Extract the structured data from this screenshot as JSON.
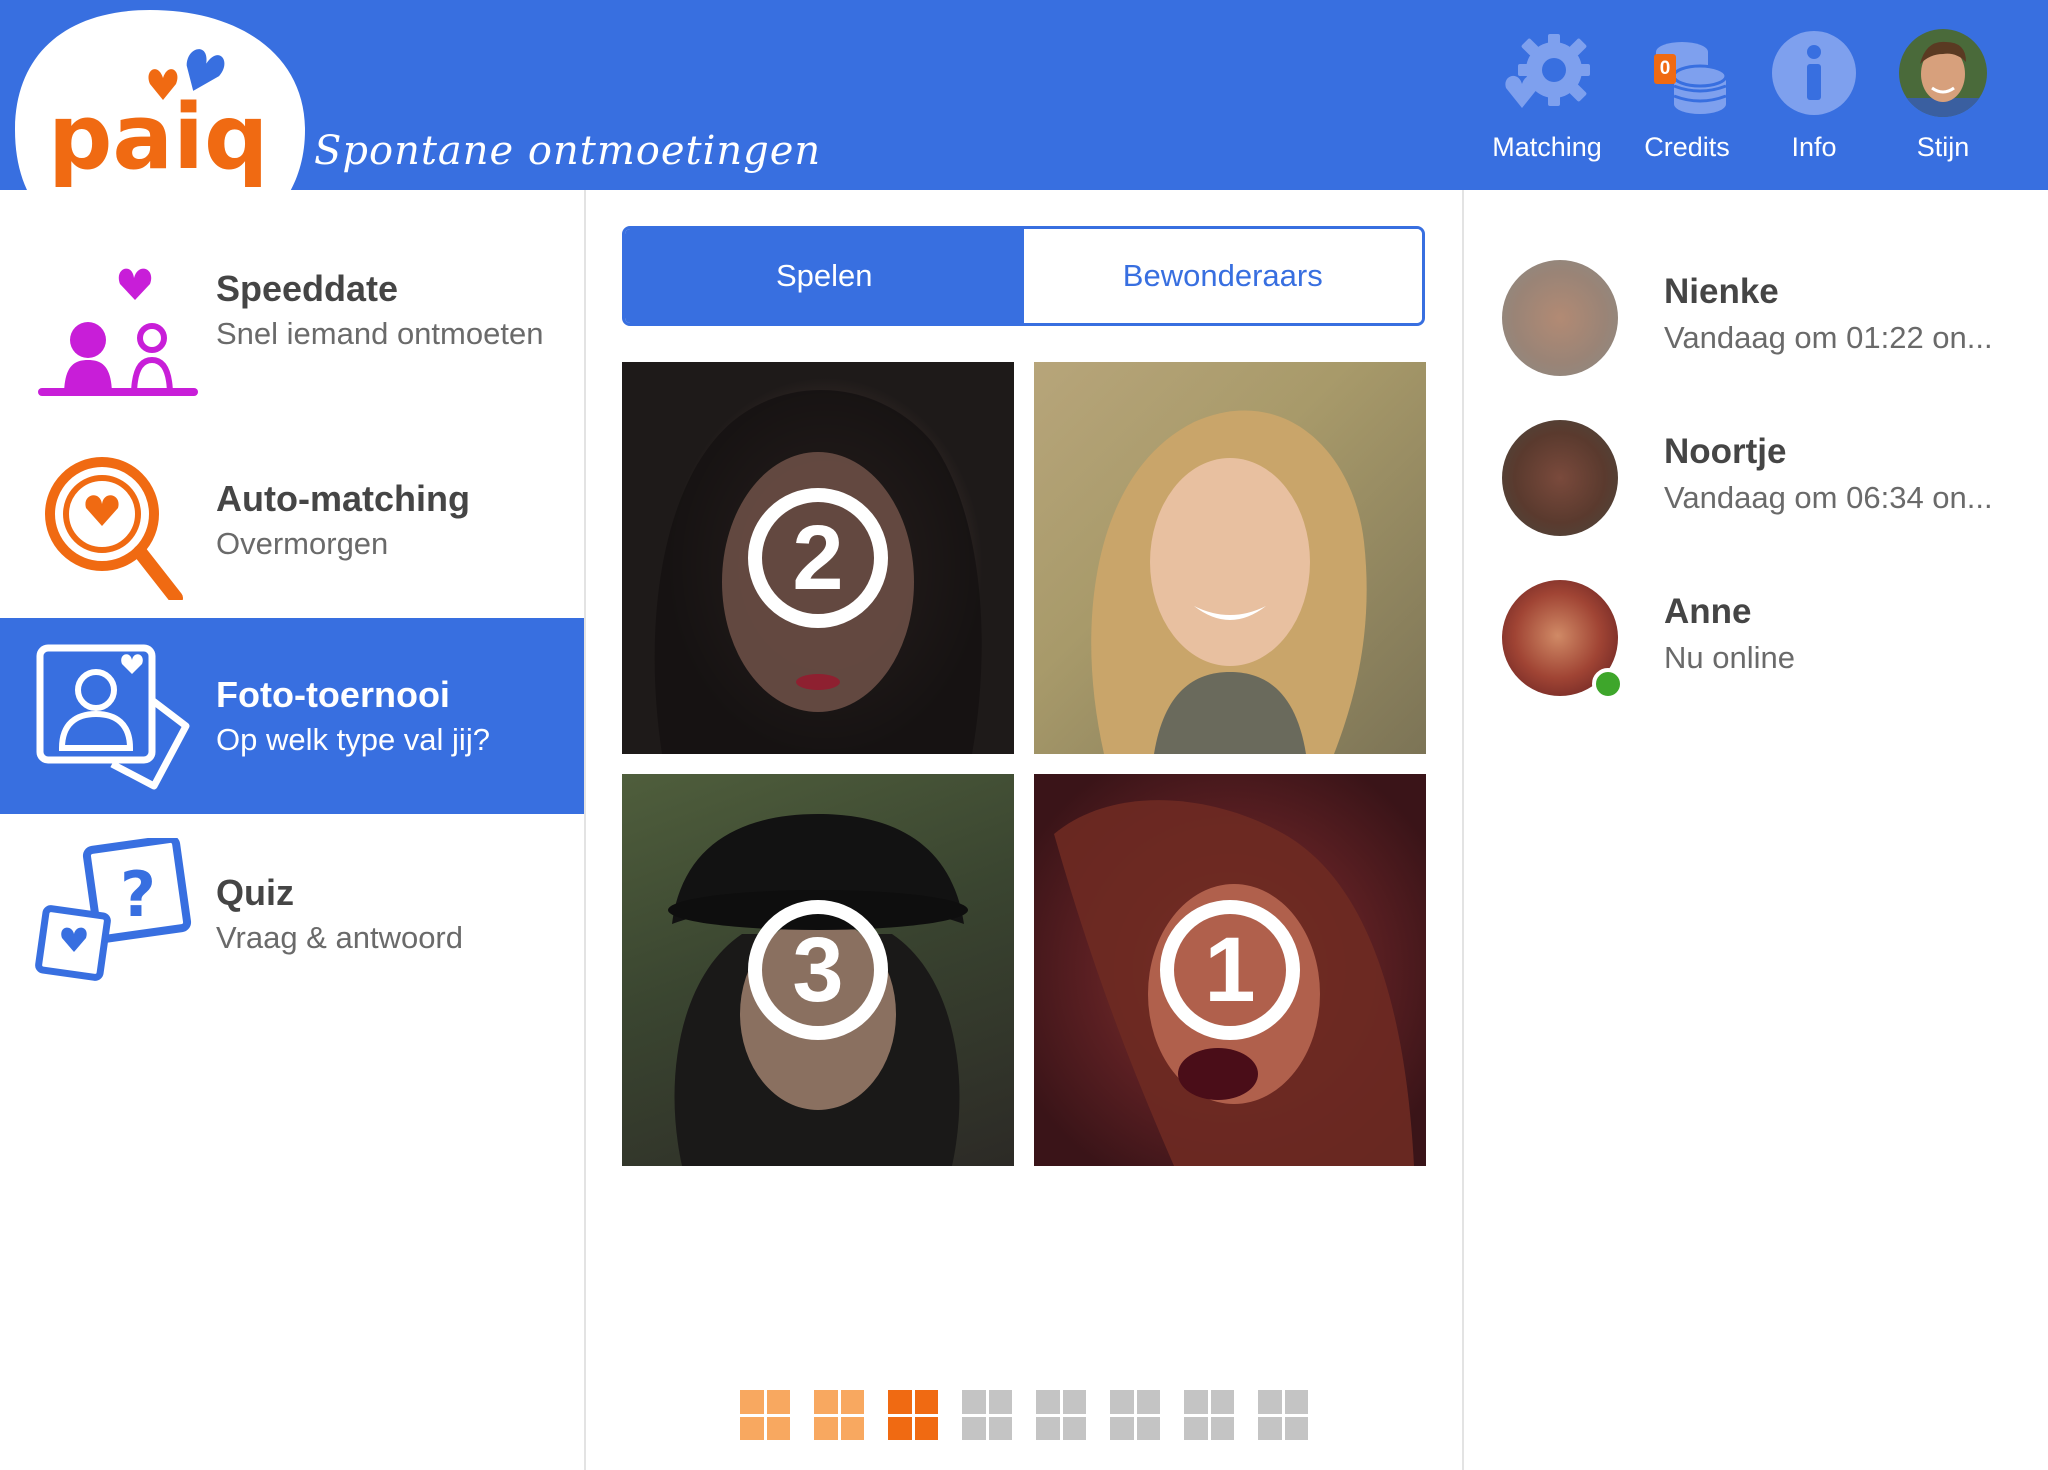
{
  "brand": {
    "logo_text": "paiq",
    "tagline": "Spontane ontmoetingen",
    "colors": {
      "primary": "#386fe0",
      "orange": "#f06a12",
      "magenta": "#c81ed8",
      "online": "#3ea62b"
    }
  },
  "topnav": [
    {
      "label": "Matching",
      "icon": "heart-gear-icon"
    },
    {
      "label": "Credits",
      "icon": "coins-icon",
      "badge": "0"
    },
    {
      "label": "Info",
      "icon": "info-icon"
    },
    {
      "label": "Stijn",
      "icon": "avatar"
    }
  ],
  "menu": [
    {
      "title": "Speeddate",
      "subtitle": "Snel iemand ontmoeten",
      "icon": "speeddate-icon",
      "active": false
    },
    {
      "title": "Auto-matching",
      "subtitle": "Overmorgen",
      "icon": "magnifier-heart-icon",
      "active": false
    },
    {
      "title": "Foto-toernooi",
      "subtitle": "Op welk type val jij?",
      "icon": "photo-tournament-icon",
      "active": true
    },
    {
      "title": "Quiz",
      "subtitle": "Vraag & antwoord",
      "icon": "quiz-icon",
      "active": false
    }
  ],
  "tabs": [
    {
      "label": "Spelen",
      "active": true
    },
    {
      "label": "Bewonderaars",
      "active": false
    }
  ],
  "photos": [
    {
      "rank": "2"
    },
    {
      "rank": ""
    },
    {
      "rank": "3"
    },
    {
      "rank": "1"
    }
  ],
  "pager": {
    "total": 8,
    "completed": 2,
    "current": 3
  },
  "contacts": [
    {
      "name": "Nienke",
      "status": "Vandaag om 01:22 on...",
      "online": false
    },
    {
      "name": "Noortje",
      "status": "Vandaag om 06:34 on...",
      "online": false
    },
    {
      "name": "Anne",
      "status": "Nu online",
      "online": true
    }
  ]
}
